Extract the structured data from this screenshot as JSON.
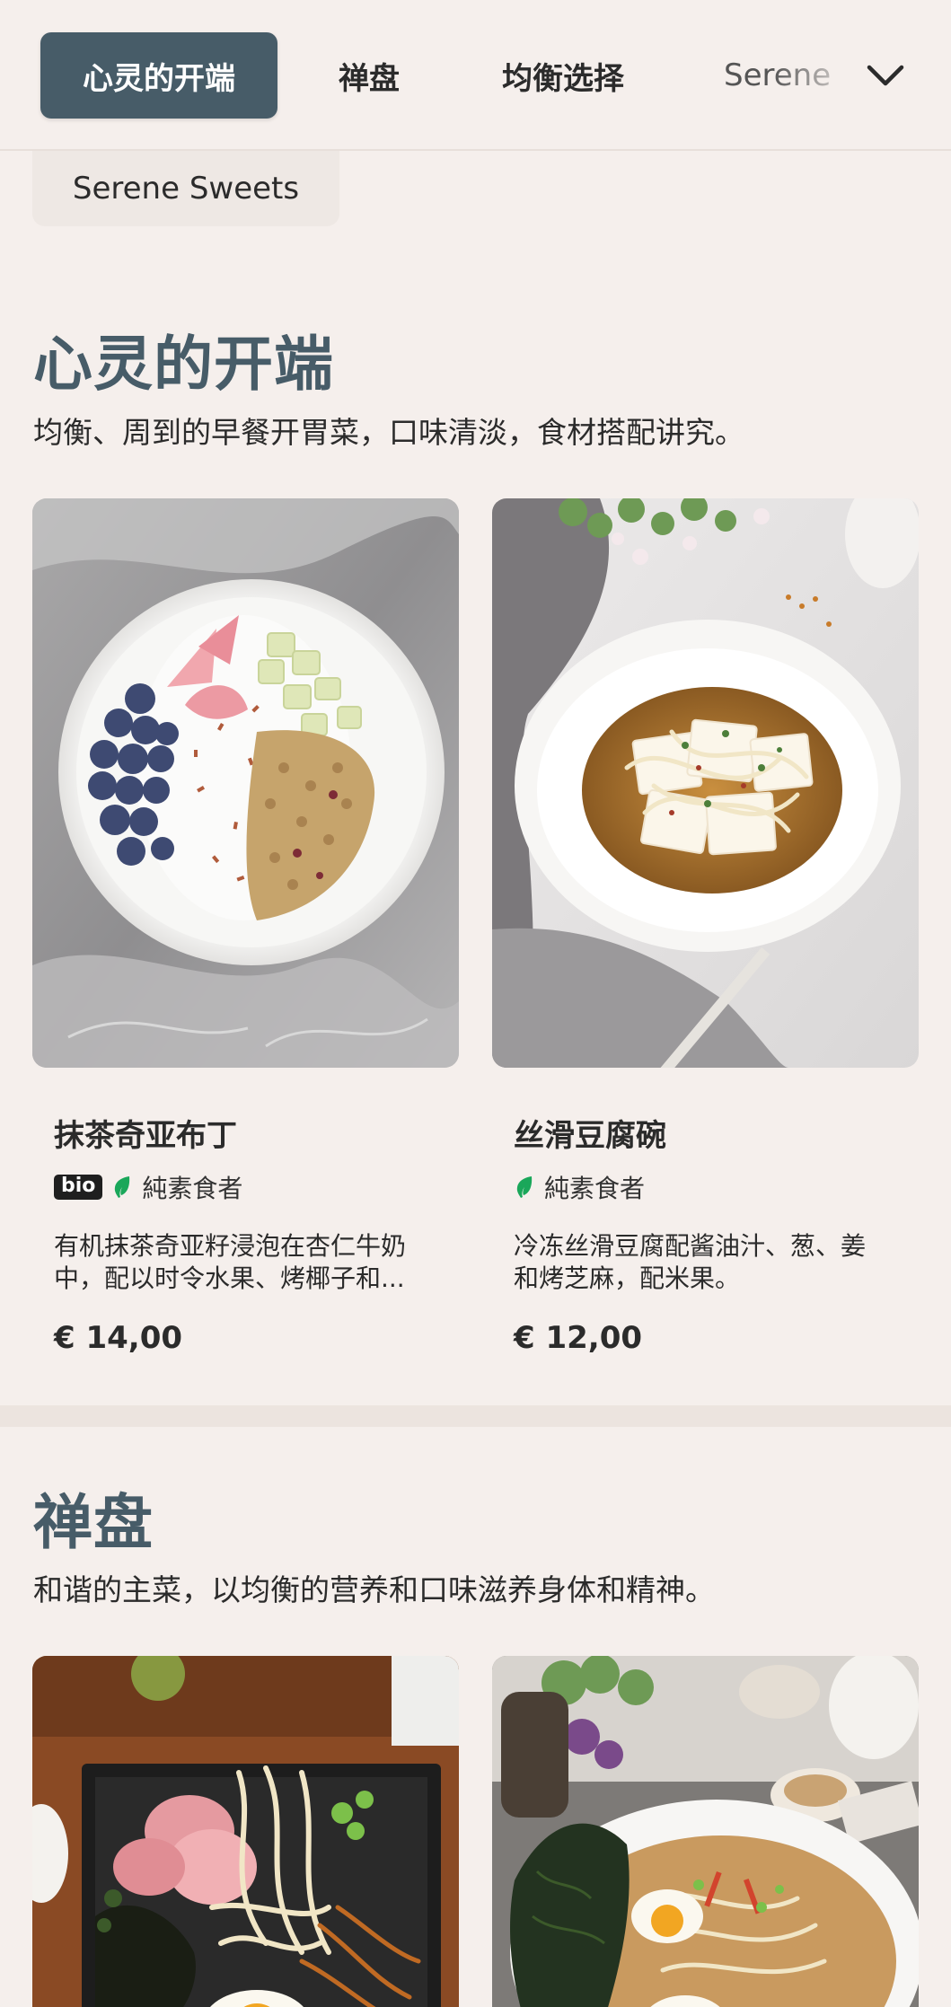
{
  "nav": {
    "tabs": [
      "心灵的开端",
      "禅盘",
      "均衡选择",
      "Serene"
    ],
    "active_index": 0
  },
  "chip": {
    "label": "Serene Sweets"
  },
  "sections": [
    {
      "title": "心灵的开端",
      "description": "均衡、周到的早餐开胃菜，口味清淡，食材搭配讲究。",
      "items": [
        {
          "name": "抹茶奇亚布丁",
          "bio_badge": "bio",
          "diet_tag": "純素食者",
          "description_line1": "有机抹茶奇亚籽浸泡在杏仁牛奶",
          "description_line2": "中，配以时令水果、烤椰子和...",
          "price": "€ 14,00"
        },
        {
          "name": "丝滑豆腐碗",
          "diet_tag": "純素食者",
          "description_line1": "冷冻丝滑豆腐配酱油汁、葱、姜",
          "description_line2": "和烤芝麻，配米果。",
          "price": "€ 12,00"
        }
      ]
    },
    {
      "title": "禅盘",
      "description": "和谐的主菜，以均衡的营养和口味滋养身体和精神。"
    }
  ],
  "colors": {
    "background": "#f5efec",
    "accent": "#475c68",
    "leaf": "#1aa75a"
  },
  "icons": {
    "nav_more": "chevron-down-icon",
    "diet": "leaf-icon"
  }
}
